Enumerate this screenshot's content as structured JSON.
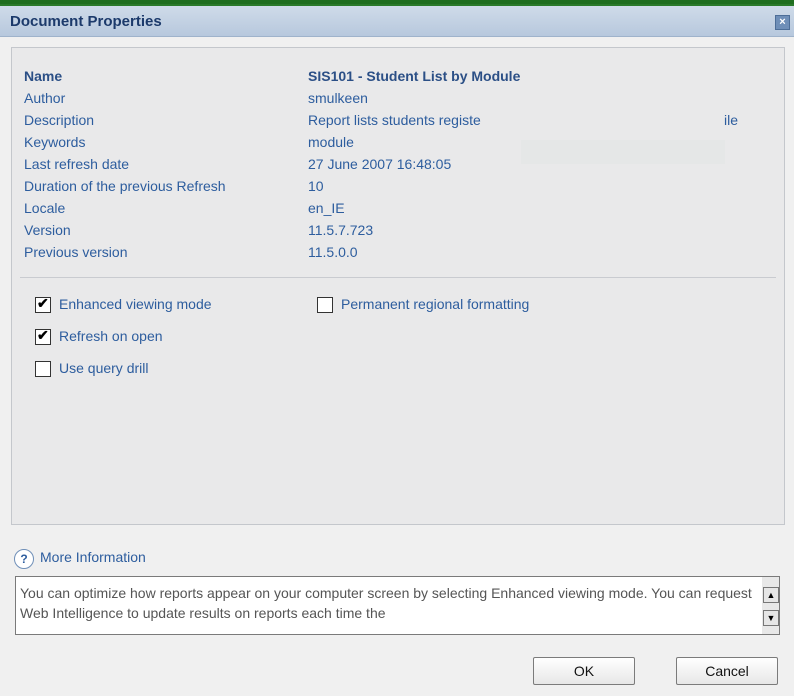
{
  "window": {
    "title": "Document Properties",
    "close_label": "×"
  },
  "properties": [
    {
      "label": "Name",
      "value": "SIS101 - Student List by Module",
      "emphasis": true
    },
    {
      "label": "Author",
      "value": "smulkeen"
    },
    {
      "label": "Description",
      "value": "Report lists students registe",
      "value_tail": "ile"
    },
    {
      "label": "Keywords",
      "value": "module"
    },
    {
      "label": "Last refresh date",
      "value": "27 June 2007 16:48:05"
    },
    {
      "label": "Duration of the previous Refresh",
      "value": "10"
    },
    {
      "label": "Locale",
      "value": "en_IE"
    },
    {
      "label": "Version",
      "value": "11.5.7.723"
    },
    {
      "label": "Previous version",
      "value": "11.5.0.0"
    }
  ],
  "options": {
    "enhanced_viewing": {
      "label": "Enhanced viewing mode",
      "checked": true
    },
    "permanent_regional": {
      "label": "Permanent regional formatting",
      "checked": false
    },
    "refresh_on_open": {
      "label": "Refresh on open",
      "checked": true
    },
    "use_query_drill": {
      "label": "Use query drill",
      "checked": false
    }
  },
  "more_info": {
    "label": "More Information",
    "icon": "help-icon",
    "text": "You can optimize how reports appear on your computer screen by selecting Enhanced viewing mode. You can request Web Intelligence to update results on reports each time the"
  },
  "buttons": {
    "ok": "OK",
    "cancel": "Cancel"
  },
  "colors": {
    "label_blue": "#2d5d9e",
    "title_blue": "#1c3a6b"
  }
}
